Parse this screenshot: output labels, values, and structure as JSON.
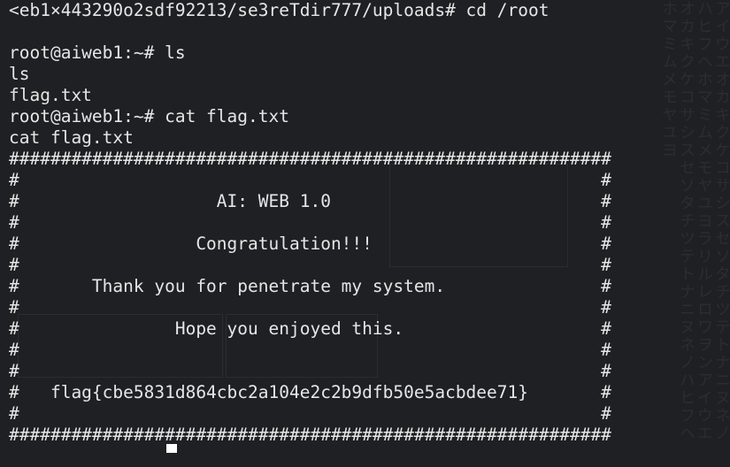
{
  "terminal": {
    "lines": [
      "<eb1×443290o2sdf92213/se3reTdir777/uploads# cd /root",
      "",
      "root@aiweb1:~# ls",
      "ls",
      "flag.txt",
      "root@aiweb1:~# cat flag.txt",
      "cat flag.txt",
      "##########################################################",
      "#                                                        #",
      "#                   AI: WEB 1.0                          #",
      "#                                                        #",
      "#                 Congratulation!!!                      #",
      "#                                                        #",
      "#       Thank you for penetrate my system.               #",
      "#                                                        #",
      "#               Hope you enjoyed this.                   #",
      "#                                                        #",
      "#                                                        #",
      "#   flag{cbe5831d864cbc2a104e2c2b9dfb50e5acbdee71}       #",
      "#                                                        #",
      "##########################################################",
      ""
    ]
  },
  "colors": {
    "background": "#1f2023",
    "text": "#e6e6e6",
    "cursor": "#ffffff"
  }
}
